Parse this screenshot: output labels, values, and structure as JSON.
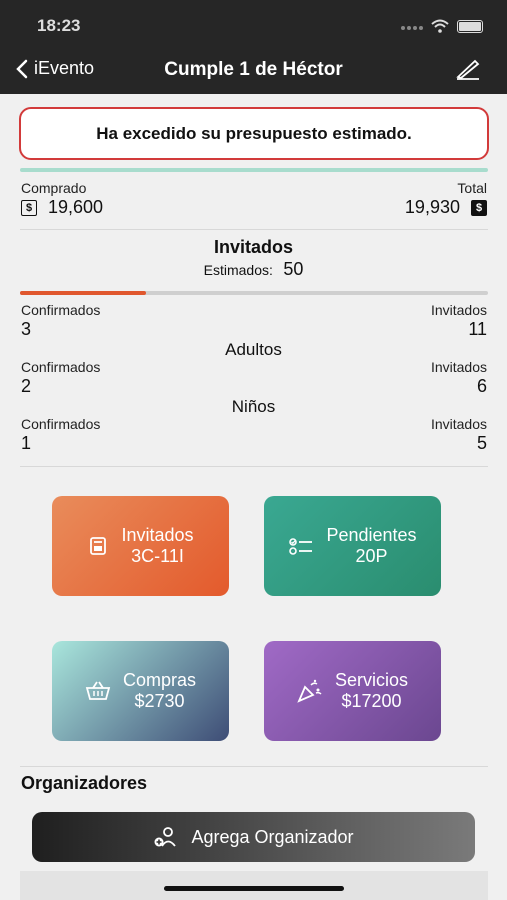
{
  "status_bar": {
    "time": "18:23"
  },
  "nav": {
    "back_label": "iEvento",
    "title": "Cumple  1 de Héctor"
  },
  "alert": {
    "message": "Ha excedido su presupuesto estimado."
  },
  "budget": {
    "purchased_label": "Comprado",
    "purchased_value": "19,600",
    "total_label": "Total",
    "total_value": "19,930",
    "currency_symbol": "$",
    "progress": 1.0
  },
  "guests": {
    "title": "Invitados",
    "estimated_label": "Estimados:",
    "estimated_value": "50",
    "progress": 0.27,
    "groups": [
      {
        "title": "",
        "confirmed_label": "Confirmados",
        "confirmed": "3",
        "invited_label": "Invitados",
        "invited": "11"
      },
      {
        "title": "Adultos",
        "confirmed_label": "Confirmados",
        "confirmed": "2",
        "invited_label": "Invitados",
        "invited": "6"
      },
      {
        "title": "Niños",
        "confirmed_label": "Confirmados",
        "confirmed": "1",
        "invited_label": "Invitados",
        "invited": "5"
      }
    ]
  },
  "cards": {
    "invitados": {
      "title": "Invitados",
      "value": "3C-11I"
    },
    "pendientes": {
      "title": "Pendientes",
      "value": "20P"
    },
    "compras": {
      "title": "Compras",
      "value": "$2730"
    },
    "servicios": {
      "title": "Servicios",
      "value": "$17200"
    }
  },
  "organizers": {
    "title": "Organizadores",
    "add_label": "Agrega Organizador"
  },
  "colors": {
    "alert_border": "#d23a3a",
    "progress_accent": "#e0572e",
    "budget_bar": "#a8dccd"
  }
}
